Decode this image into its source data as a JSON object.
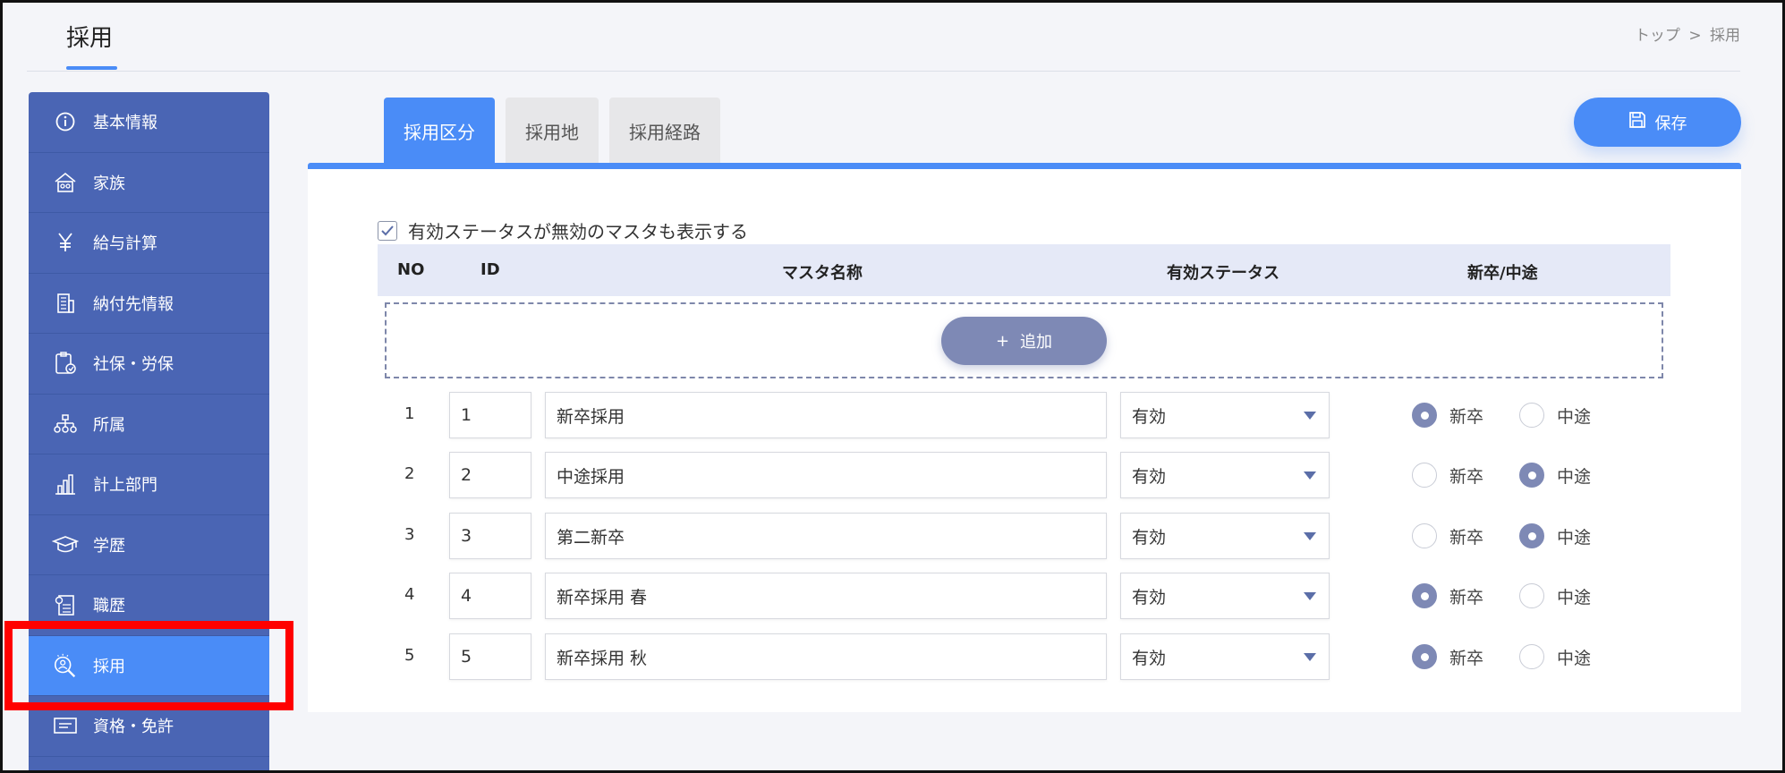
{
  "header": {
    "title": "採用",
    "breadcrumb": [
      "トップ",
      "採用"
    ],
    "breadcrumb_separator": ">"
  },
  "sidebar": {
    "items": [
      {
        "label": "基本情報",
        "icon": "info-icon"
      },
      {
        "label": "家族",
        "icon": "house-icon"
      },
      {
        "label": "給与計算",
        "icon": "yen-icon"
      },
      {
        "label": "納付先情報",
        "icon": "building-icon"
      },
      {
        "label": "社保・労保",
        "icon": "clipboard-shield-icon"
      },
      {
        "label": "所属",
        "icon": "org-chart-icon"
      },
      {
        "label": "計上部門",
        "icon": "bar-chart-icon"
      },
      {
        "label": "学歴",
        "icon": "graduation-cap-icon"
      },
      {
        "label": "職歴",
        "icon": "resume-icon"
      },
      {
        "label": "採用",
        "icon": "magnifier-person-icon",
        "active": true
      },
      {
        "label": "資格・免許",
        "icon": "certificate-icon"
      }
    ]
  },
  "tabs": [
    {
      "label": "採用区分",
      "active": true
    },
    {
      "label": "採用地",
      "active": false
    },
    {
      "label": "採用経路",
      "active": false
    }
  ],
  "save_label": "保存",
  "show_inactive_label": "有効ステータスが無効のマスタも表示する",
  "show_inactive_checked": true,
  "table": {
    "headers": {
      "no": "NO",
      "id": "ID",
      "name": "マスタ名称",
      "status": "有効ステータス",
      "type": "新卒/中途"
    },
    "add_label": "追加",
    "radio_labels": {
      "new": "新卒",
      "mid": "中途"
    },
    "rows": [
      {
        "no": "1",
        "id": "1",
        "name": "新卒採用",
        "status": "有効",
        "type": "new"
      },
      {
        "no": "2",
        "id": "2",
        "name": "中途採用",
        "status": "有効",
        "type": "mid"
      },
      {
        "no": "3",
        "id": "3",
        "name": "第二新卒",
        "status": "有効",
        "type": "mid"
      },
      {
        "no": "4",
        "id": "4",
        "name": "新卒採用 春",
        "status": "有効",
        "type": "new"
      },
      {
        "no": "5",
        "id": "5",
        "name": "新卒採用 秋",
        "status": "有効",
        "type": "new"
      }
    ]
  },
  "colors": {
    "accent": "#4a8cf7",
    "sidebar": "#4a65b4",
    "highlight": "#ff0000",
    "radio_on": "#7e89b5"
  }
}
